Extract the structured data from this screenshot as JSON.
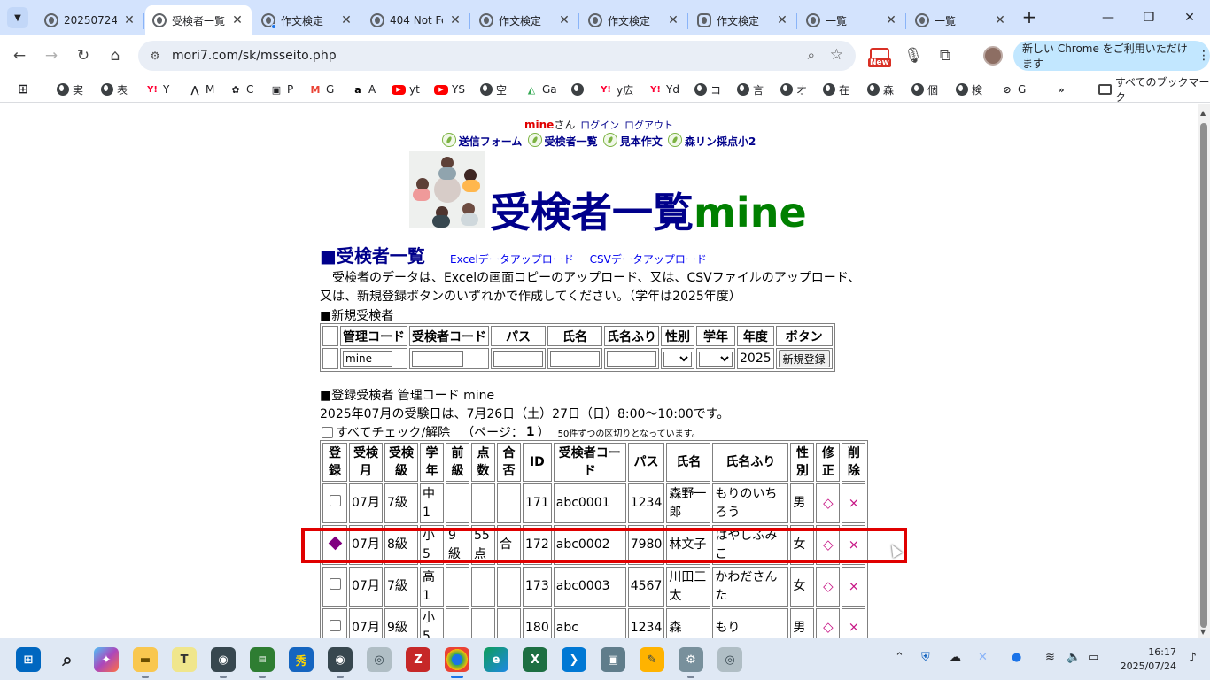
{
  "browser": {
    "tabs": [
      {
        "title": "20250724",
        "active": false
      },
      {
        "title": "受検者一覧",
        "active": true
      },
      {
        "title": "作文検定",
        "active": false
      },
      {
        "title": "404 Not Found",
        "active": false
      },
      {
        "title": "作文検定",
        "active": false
      },
      {
        "title": "作文検定",
        "active": false
      },
      {
        "title": "作文検定",
        "active": false
      },
      {
        "title": "一覧",
        "active": false
      },
      {
        "title": "一覧",
        "active": false
      }
    ],
    "url": "mori7.com/sk/msseito.php",
    "new_badge": "New",
    "update_label": "新しい Chrome をご利用いただけます",
    "bookmarks": [
      "実",
      "表",
      "Y",
      "M",
      "C",
      "P",
      "G",
      "A",
      "yt",
      "YS",
      "空",
      "Ga",
      "",
      "y広",
      "Yd",
      "コ",
      "言",
      "オ",
      "在",
      "森",
      "個",
      "検",
      "G"
    ],
    "all_bookmarks": "すべてのブックマーク"
  },
  "page": {
    "user": "mine",
    "san": "さん",
    "login": "ログイン",
    "logout": "ログアウト",
    "nav": [
      "送信フォーム",
      "受検者一覧",
      "見本作文",
      "森リン採点小2"
    ],
    "title_main": "受検者一覧",
    "title_sub": "mine",
    "section_title": "■受検者一覧",
    "excel_upload": "Excelデータアップロード",
    "csv_upload": "CSVデータアップロード",
    "desc_line1": "　受検者のデータは、Excelの画面コピーのアップロード、又は、CSVファイルのアップロード、",
    "desc_line2": "又は、新規登録ボタンのいずれかで作成してください。（学年は2025年度）",
    "new_heading": "■新規受検者",
    "new_table": {
      "headers": [
        "",
        "管理コード",
        "受検者コード",
        "パス",
        "氏名",
        "氏名ふり",
        "性別",
        "学年",
        "年度",
        "ボタン"
      ],
      "admin_code_value": "mine",
      "year": "2025",
      "register_button": "新規登録"
    },
    "registered_heading": "■登録受検者 管理コード mine",
    "exam_notice": "2025年07月の受験日は、7月26日（土）27日（日）8:00〜10:00です。",
    "check_all": "すべてチェック/解除",
    "page_label": "（ページ：",
    "page_num": "1",
    "page_close": "）",
    "per_page_note": "50件ずつの区切りとなっています。",
    "list_headers": [
      "登\n録",
      "受検\n月",
      "受検\n級",
      "学\n年",
      "前\n級",
      "点\n数",
      "合\n否",
      "ID",
      "受検者コー\nド",
      "パス",
      "氏名",
      "氏名ふり",
      "性\n別",
      "修\n正",
      "削\n除"
    ],
    "rows": [
      {
        "reg": "checkbox",
        "month": "07月",
        "grade_level": "7級",
        "school_year": "中1",
        "prev": "",
        "score": "",
        "result": "",
        "id": "171",
        "code": "abc0001",
        "pass": "1234",
        "name": "森野一郎",
        "furi": "もりのいちろう",
        "sex": "男"
      },
      {
        "reg": "diamond",
        "month": "07月",
        "grade_level": "8級",
        "school_year": "小5",
        "prev": "9級",
        "score": "55点",
        "result": "合",
        "id": "172",
        "code": "abc0002",
        "pass": "7980",
        "name": "林文子",
        "furi": "はやしふみこ",
        "sex": "女"
      },
      {
        "reg": "checkbox",
        "month": "07月",
        "grade_level": "7級",
        "school_year": "高1",
        "prev": "",
        "score": "",
        "result": "",
        "id": "173",
        "code": "abc0003",
        "pass": "4567",
        "name": "川田三太",
        "furi": "かわださんた",
        "sex": "女"
      },
      {
        "reg": "checkbox",
        "month": "07月",
        "grade_level": "9級",
        "school_year": "小5",
        "prev": "",
        "score": "",
        "result": "",
        "id": "180",
        "code": "abc",
        "pass": "1234",
        "name": "森",
        "furi": "もり",
        "sex": "男"
      }
    ],
    "edit_symbol": "◇",
    "delete_symbol": "×"
  },
  "taskbar": {
    "time": "16:17",
    "date": "2025/07/24"
  }
}
